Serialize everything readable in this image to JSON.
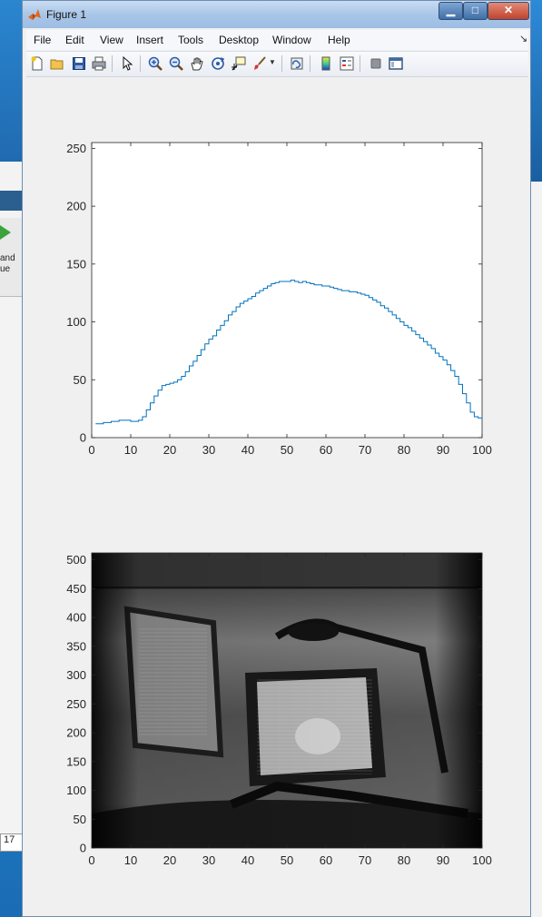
{
  "window": {
    "title": "Figure 1"
  },
  "menu": [
    "File",
    "Edit",
    "View",
    "Insert",
    "Tools",
    "Desktop",
    "Window",
    "Help"
  ],
  "toolbar_icons": [
    "new-figure-icon",
    "open-file-icon",
    "save-icon",
    "print-icon",
    "select-arrow-icon",
    "zoom-in-icon",
    "zoom-out-icon",
    "pan-hand-icon",
    "rotate-3d-icon",
    "data-cursor-icon",
    "brush-icon",
    "link-plot-icon",
    "colorbar-icon",
    "legend-icon",
    "hide-plot-tools-icon",
    "show-plot-tools-icon"
  ],
  "background_app": {
    "left_text": [
      "and",
      "ue"
    ],
    "left_number": "17"
  },
  "colors": {
    "line": "#0072bd",
    "axes": "#262626"
  },
  "chart_data": [
    {
      "type": "line",
      "title": "",
      "xlabel": "",
      "ylabel": "",
      "xlim": [
        0,
        100
      ],
      "ylim": [
        0,
        255
      ],
      "xticks": [
        "0",
        "10",
        "20",
        "30",
        "40",
        "50",
        "60",
        "70",
        "80",
        "90",
        "100"
      ],
      "yticks": [
        "0",
        "50",
        "100",
        "150",
        "200",
        "250"
      ],
      "step": true,
      "x": [
        1,
        2,
        3,
        4,
        5,
        6,
        7,
        8,
        9,
        10,
        11,
        12,
        13,
        14,
        15,
        16,
        17,
        18,
        19,
        20,
        21,
        22,
        23,
        24,
        25,
        26,
        27,
        28,
        29,
        30,
        31,
        32,
        33,
        34,
        35,
        36,
        37,
        38,
        39,
        40,
        41,
        42,
        43,
        44,
        45,
        46,
        47,
        48,
        49,
        50,
        51,
        52,
        53,
        54,
        55,
        56,
        57,
        58,
        59,
        60,
        61,
        62,
        63,
        64,
        65,
        66,
        67,
        68,
        69,
        70,
        71,
        72,
        73,
        74,
        75,
        76,
        77,
        78,
        79,
        80,
        81,
        82,
        83,
        84,
        85,
        86,
        87,
        88,
        89,
        90,
        91,
        92,
        93,
        94,
        95,
        96,
        97,
        98,
        99,
        100
      ],
      "y": [
        12,
        12,
        13,
        13,
        14,
        14,
        15,
        15,
        15,
        14,
        14,
        15,
        18,
        24,
        30,
        36,
        41,
        45,
        46,
        47,
        48,
        50,
        53,
        57,
        62,
        66,
        71,
        76,
        81,
        85,
        88,
        93,
        97,
        101,
        106,
        109,
        113,
        116,
        118,
        120,
        122,
        125,
        127,
        129,
        131,
        133,
        134,
        135,
        135,
        135,
        136,
        135,
        134,
        135,
        134,
        133,
        132,
        132,
        131,
        131,
        130,
        129,
        128,
        127,
        127,
        126,
        126,
        125,
        124,
        123,
        121,
        119,
        117,
        114,
        112,
        109,
        106,
        103,
        100,
        97,
        95,
        92,
        89,
        86,
        83,
        80,
        77,
        73,
        70,
        67,
        63,
        58,
        53,
        46,
        38,
        30,
        22,
        18,
        17,
        18
      ]
    },
    {
      "type": "heatmap",
      "title": "",
      "xlabel": "",
      "ylabel": "",
      "xlim": [
        0,
        100
      ],
      "ylim": [
        0,
        512
      ],
      "xticks": [
        "0",
        "10",
        "20",
        "30",
        "40",
        "50",
        "60",
        "70",
        "80",
        "90",
        "100"
      ],
      "yticks": [
        "0",
        "50",
        "100",
        "150",
        "200",
        "250",
        "300",
        "350",
        "400",
        "450",
        "500"
      ],
      "colormap": "gray"
    }
  ]
}
